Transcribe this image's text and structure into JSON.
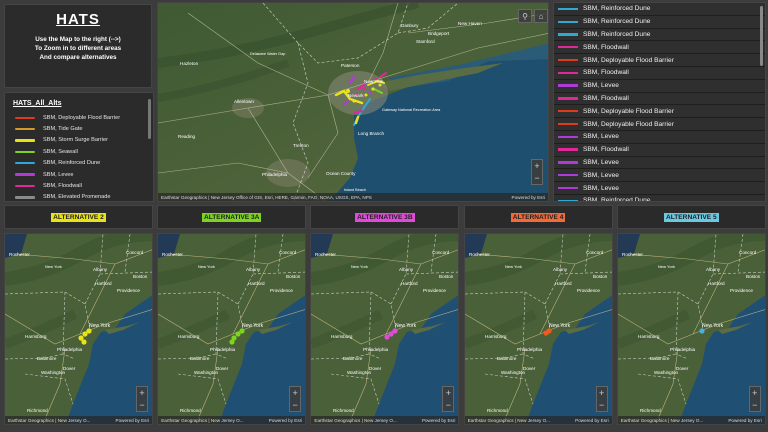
{
  "header": {
    "title": "HATS",
    "instructions": [
      "Use the Map to the right (-->)",
      "To Zoom in to different areas",
      "And compare alternatives"
    ]
  },
  "legend": {
    "title": "HATS_All_Alts",
    "items": [
      {
        "label": "SBM, Deployable Flood Barrier",
        "color": "#e03a1e"
      },
      {
        "label": "SBM, Tide Gate",
        "color": "#d49b2a"
      },
      {
        "label": "SBM, Storm Surge Barrier",
        "color": "#e8e21a"
      },
      {
        "label": "SBM, Seawall",
        "color": "#7ed321"
      },
      {
        "label": "SBM, Reinforced Dune",
        "color": "#2fa8d8"
      },
      {
        "label": "SBM, Levee",
        "color": "#b03ad8"
      },
      {
        "label": "SBM, Floodwall",
        "color": "#e0289a"
      },
      {
        "label": "SBM, Elevated Promenade",
        "color": "#8a8a8a"
      }
    ]
  },
  "main_map": {
    "labels": [
      "New Haven",
      "Stamford",
      "Danbury",
      "Bridgeport",
      "Paterson",
      "New York",
      "Newark",
      "Long Branch",
      "Trenton",
      "Allentown",
      "Philadelphia",
      "Reading",
      "Hazleton",
      "Ocean County",
      "Gateway National Recreation Area",
      "Delaware Water Gap",
      "Island Beach"
    ],
    "attribution": "Earthstar Geographics | New Jersey Office of GIS, Esri, HERE, Garmin, FAO, NOAA, USGS, EPA, NPS",
    "powered_by": "Powered by Esri",
    "zoom_in": "+",
    "zoom_out": "−"
  },
  "feature_list": {
    "items": [
      {
        "label": "SBM, Reinforced Dune",
        "color": "#2fa8d8"
      },
      {
        "label": "SBM, Reinforced Dune",
        "color": "#2fa8d8"
      },
      {
        "label": "SBM, Reinforced Dune",
        "color": "#2fa8d8"
      },
      {
        "label": "SBM, Floodwall",
        "color": "#e0289a"
      },
      {
        "label": "SBM, Deployable Flood Barrier",
        "color": "#e03a1e"
      },
      {
        "label": "SBM, Floodwall",
        "color": "#e0289a"
      },
      {
        "label": "SBM, Levee",
        "color": "#b03ad8"
      },
      {
        "label": "SBM, Floodwall",
        "color": "#e0289a"
      },
      {
        "label": "SBM, Deployable Flood Barrier",
        "color": "#e03a1e"
      },
      {
        "label": "SBM, Deployable Flood Barrier",
        "color": "#e03a1e"
      },
      {
        "label": "SBM, Levee",
        "color": "#b03ad8"
      },
      {
        "label": "SBM, Floodwall",
        "color": "#e0289a"
      },
      {
        "label": "SBM, Levee",
        "color": "#b03ad8"
      },
      {
        "label": "SBM, Levee",
        "color": "#b03ad8"
      },
      {
        "label": "SBM, Levee",
        "color": "#b03ad8"
      },
      {
        "label": "SBM, Reinforced Dune",
        "color": "#2fa8d8"
      }
    ]
  },
  "alternatives": [
    {
      "label": "ALTERNATIVE 2",
      "bg": "#e8e21a",
      "marker": "#e8e21a"
    },
    {
      "label": "ALTERNATIVE 3A",
      "bg": "#7ed321",
      "marker": "#7ed321"
    },
    {
      "label": "ALTERNATIVE 3B",
      "bg": "#e04ad8",
      "marker": "#e04ad8"
    },
    {
      "label": "ALTERNATIVE 4",
      "bg": "#f06a3a",
      "marker": "#f05a1e"
    },
    {
      "label": "ALTERNATIVE 5",
      "bg": "#6ac8e0",
      "marker": "#4ab0d8"
    }
  ],
  "alt_map": {
    "labels": [
      "Rochester",
      "Albany",
      "Concord",
      "Boston",
      "New York",
      "Hartford",
      "Providence",
      "Harrisburg",
      "Philadelphia",
      "Baltimore",
      "Dover",
      "Washington",
      "Richmond"
    ],
    "attribution": "Earthstar Geographics | New Jersey O...",
    "powered_by": "Powered by Esri",
    "zoom_in": "+",
    "zoom_out": "−"
  }
}
